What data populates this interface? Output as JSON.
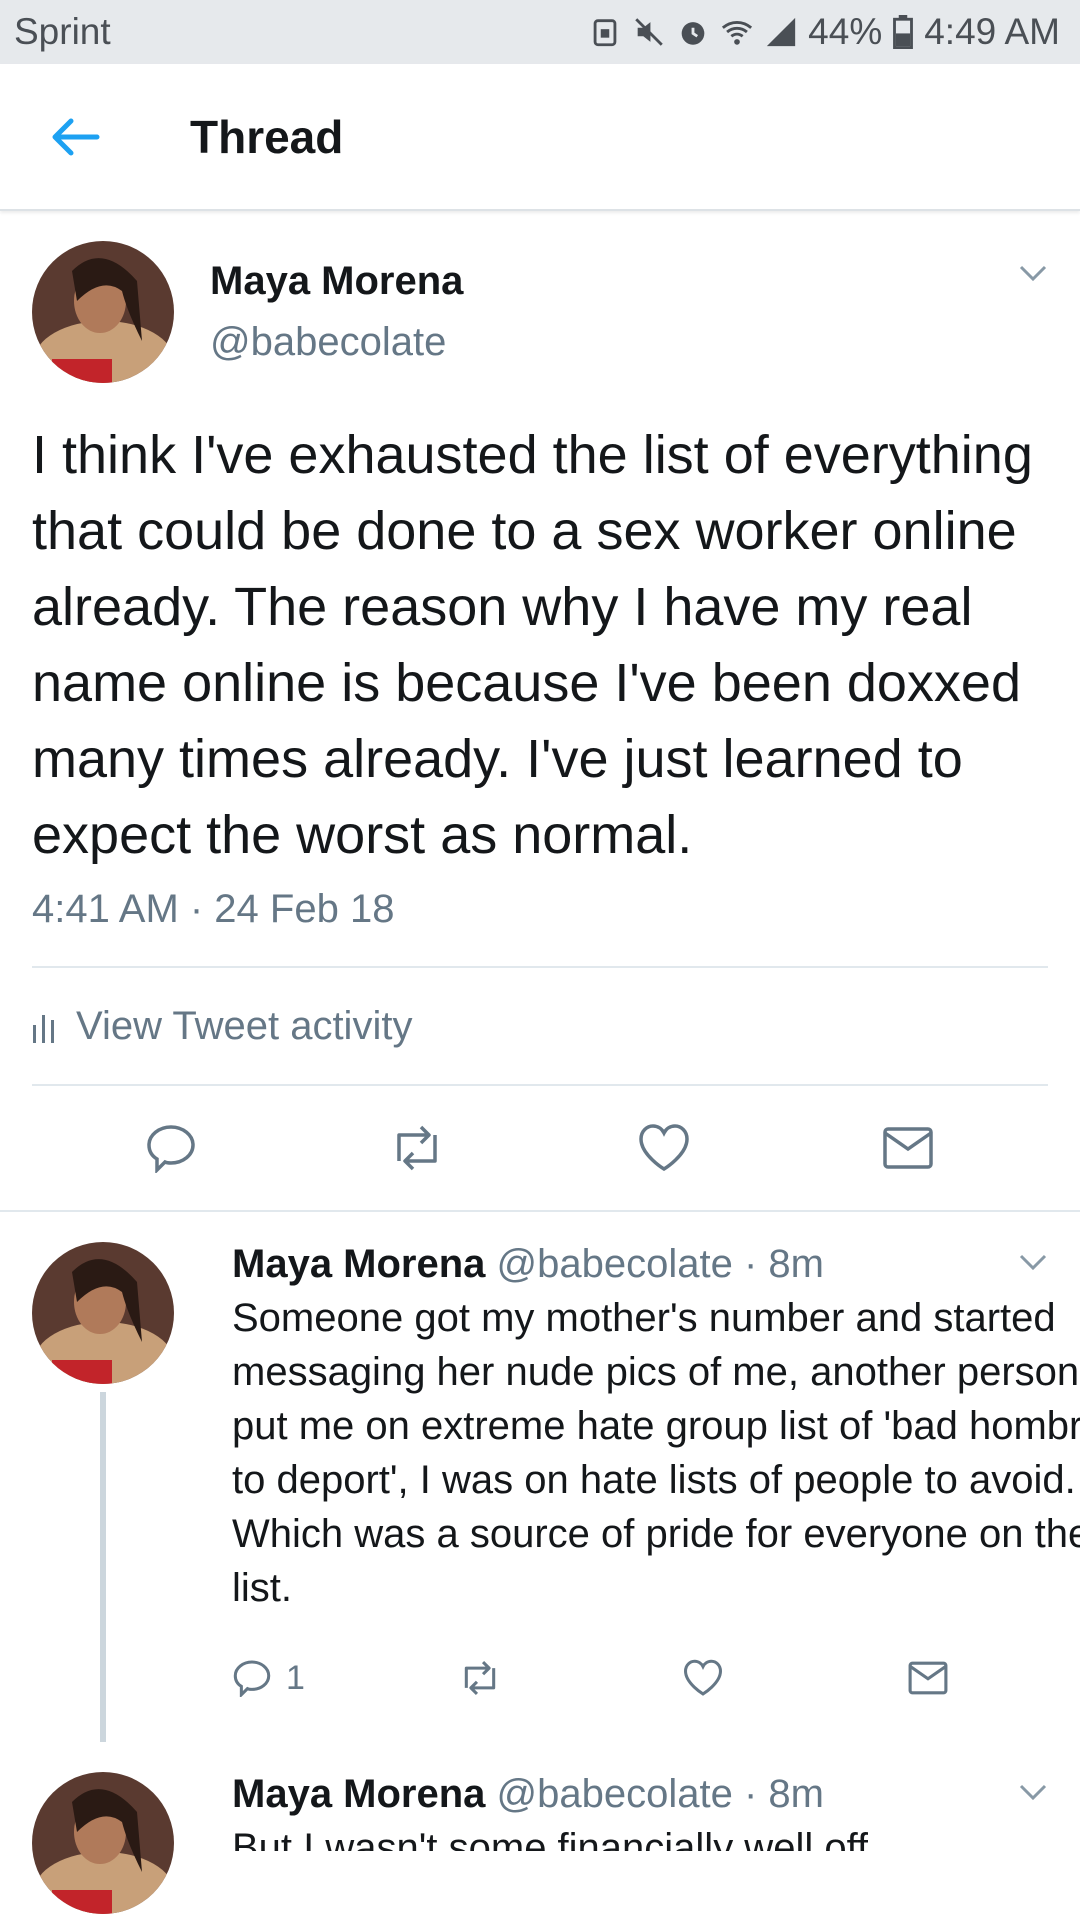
{
  "status_bar": {
    "carrier": "Sprint",
    "battery": "44%",
    "time": "4:49 AM"
  },
  "header": {
    "title": "Thread",
    "accent_color": "#1da1f2"
  },
  "main_tweet": {
    "display_name": "Maya Morena",
    "handle": "@babecolate",
    "text": "I think I've exhausted the list of everything that could be done to a sex worker online already. The reason why I have my real name online is because I've been doxxed many times already. I've just learned to expect the worst as normal.",
    "timestamp": "4:41 AM · 24 Feb 18",
    "activity_label": "View Tweet activity"
  },
  "replies": [
    {
      "display_name": "Maya Morena",
      "handle_time": "@babecolate · 8m",
      "text": "Someone got my mother's number and started messaging her nude pics of me, another person put me on extreme hate group list of 'bad hombres to deport', I was on hate lists of people to avoid. Which was a source of pride for everyone on the list.",
      "reply_count": "1"
    },
    {
      "display_name": "Maya Morena",
      "handle_time": "@babecolate · 8m",
      "text": "But I wasn't some financially well off"
    }
  ],
  "icons": {
    "back": "arrow-left-icon",
    "caret": "chevron-down-icon",
    "reply": "speech-bubble-icon",
    "retweet": "retweet-icon",
    "like": "heart-icon",
    "dm": "envelope-icon",
    "activity": "bar-chart-icon"
  }
}
